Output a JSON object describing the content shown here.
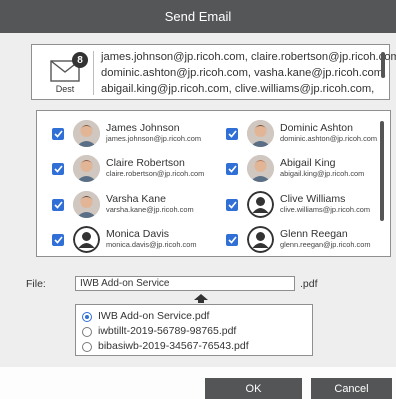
{
  "dialog": {
    "title": "Send Email"
  },
  "destination": {
    "label": "Dest",
    "count": "8",
    "lines": [
      "james.johnson@jp.ricoh.com, claire.robertson@jp.ricoh.com,",
      "dominic.ashton@jp.ricoh.com, vasha.kane@jp.ricoh.com,",
      "abigail.king@jp.ricoh.com, clive.williams@jp.ricoh.com,"
    ]
  },
  "contacts": [
    {
      "name": "James Johnson",
      "email": "james.johnson@jp.ricoh.com",
      "checked": true,
      "avatar": "person-photo"
    },
    {
      "name": "Dominic Ashton",
      "email": "dominic.ashton@jp.ricoh.com",
      "checked": true,
      "avatar": "person-photo"
    },
    {
      "name": "Claire Robertson",
      "email": "claire.robertson@jp.ricoh.com",
      "checked": true,
      "avatar": "person-photo"
    },
    {
      "name": "Abigail King",
      "email": "abigail.king@jp.ricoh.com",
      "checked": true,
      "avatar": "person-photo"
    },
    {
      "name": "Varsha Kane",
      "email": "varsha.kane@jp.ricoh.com",
      "checked": true,
      "avatar": "person-photo"
    },
    {
      "name": "Clive Williams",
      "email": "clive.williams@jp.ricoh.com",
      "checked": true,
      "avatar": "person-placeholder"
    },
    {
      "name": "Monica Davis",
      "email": "monica.davis@jp.ricoh.com",
      "checked": true,
      "avatar": "person-placeholder"
    },
    {
      "name": "Glenn Reegan",
      "email": "glenn.reegan@jp.ricoh.com",
      "checked": true,
      "avatar": "person-placeholder"
    }
  ],
  "file": {
    "label": "File:",
    "value": "IWB Add-on Service",
    "extension": ".pdf",
    "options": [
      {
        "label": "IWB Add-on Service.pdf",
        "selected": true
      },
      {
        "label": "iwbtillt-2019-56789-98765.pdf",
        "selected": false
      },
      {
        "label": "bibasiwb-2019-34567-76543.pdf",
        "selected": false
      }
    ]
  },
  "buttons": {
    "ok": "OK",
    "cancel": "Cancel"
  },
  "colors": {
    "titlebar": "#555658",
    "accent": "#2f6fd6",
    "button": "#545556"
  }
}
